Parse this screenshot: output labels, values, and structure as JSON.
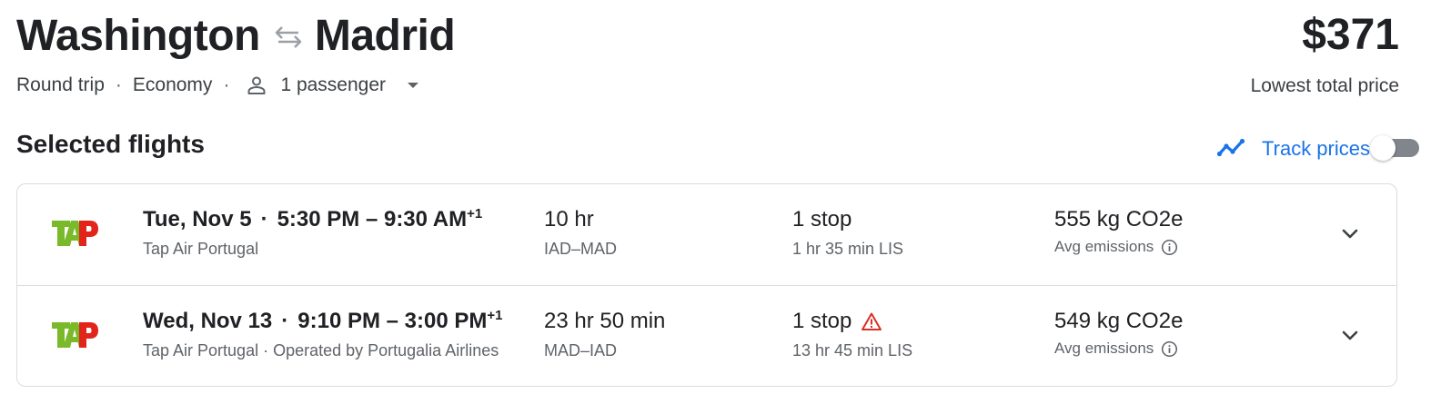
{
  "header": {
    "origin": "Washington",
    "destination": "Madrid",
    "price": "$371",
    "price_caption": "Lowest total price",
    "trip_type": "Round trip",
    "cabin": "Economy",
    "passengers": "1 passenger",
    "separator": "·"
  },
  "selected": {
    "title": "Selected flights",
    "track_label": "Track prices",
    "track_enabled": false
  },
  "flights": [
    {
      "date": "Tue, Nov 5",
      "depart": "5:30 PM",
      "arrive": "9:30 AM",
      "day_offset": "+1",
      "airline": "Tap Air Portugal",
      "operated_by": "",
      "duration": "10 hr",
      "route": "IAD–MAD",
      "stops": "1 stop",
      "stop_warning": false,
      "layover": "1 hr 35 min LIS",
      "emissions": "555 kg CO2e",
      "emissions_label": "Avg emissions"
    },
    {
      "date": "Wed, Nov 13",
      "depart": "9:10 PM",
      "arrive": "3:00 PM",
      "day_offset": "+1",
      "airline": "Tap Air Portugal",
      "operated_by": " · Operated by Portugalia Airlines",
      "duration": "23 hr 50 min",
      "route": "MAD–IAD",
      "stops": "1 stop",
      "stop_warning": true,
      "layover": "13 hr 45 min LIS",
      "emissions": "549 kg CO2e",
      "emissions_label": "Avg emissions"
    }
  ],
  "colors": {
    "link": "#1a73e8",
    "text": "#202124",
    "secondary": "#5f6368",
    "warning": "#d93025",
    "tap_green": "#7ab929",
    "tap_red": "#e1251b"
  },
  "icons": {
    "swap": "swap-arrows-icon",
    "passenger": "person-icon",
    "dropdown": "caret-down-icon",
    "track": "trending-line-icon",
    "info": "info-icon",
    "warning": "warning-triangle-icon",
    "expand": "chevron-down-icon",
    "logo": "tap-logo"
  }
}
